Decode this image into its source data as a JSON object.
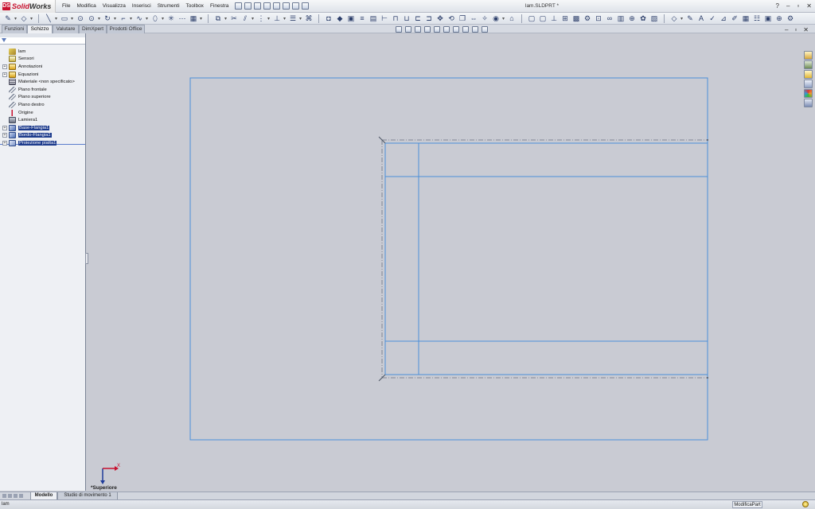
{
  "app": {
    "brand_bold": "Solid",
    "brand_rest": "Works",
    "logo_mark": "DS",
    "document_title": "lam.SLDPRT *"
  },
  "menu": [
    "File",
    "Modifica",
    "Visualizza",
    "Inserisci",
    "Strumenti",
    "Toolbox",
    "Finestra"
  ],
  "window_controls": {
    "help": "?",
    "minimize": "–",
    "restore": "▫",
    "close": "✕"
  },
  "command_tabs": [
    "Funzioni",
    "Schizzo",
    "Valutare",
    "DimXpert",
    "Prodotti Office"
  ],
  "active_command_tab": "Schizzo",
  "feature_tree": {
    "root": "lam",
    "items": [
      {
        "label": "Sensori",
        "expander": false,
        "icon": "sensor-icon",
        "selected": false
      },
      {
        "label": "Annotazioni",
        "expander": true,
        "icon": "annotations-icon",
        "selected": false
      },
      {
        "label": "Equazioni",
        "expander": true,
        "icon": "equations-icon",
        "selected": false
      },
      {
        "label": "Materiale <non specificato>",
        "expander": false,
        "icon": "material-icon",
        "selected": false
      },
      {
        "label": "Piano frontale",
        "expander": false,
        "icon": "plane-icon",
        "selected": false
      },
      {
        "label": "Piano superiore",
        "expander": false,
        "icon": "plane-icon",
        "selected": false
      },
      {
        "label": "Piano destro",
        "expander": false,
        "icon": "plane-icon",
        "selected": false
      },
      {
        "label": "Origine",
        "expander": false,
        "icon": "origin-icon",
        "selected": false
      },
      {
        "label": "Lamiera1",
        "expander": false,
        "icon": "sheet-metal-icon",
        "selected": false
      },
      {
        "label": "Base-Flangia1",
        "expander": true,
        "icon": "base-flange-icon",
        "selected": true
      },
      {
        "label": "Bordo-Flangia1",
        "expander": true,
        "icon": "edge-flange-icon",
        "selected": true
      },
      {
        "label": "Proiezione piatta1",
        "expander": true,
        "icon": "flat-pattern-icon",
        "selected": true
      }
    ]
  },
  "view": {
    "orientation_label": "*Superiore",
    "triad_x_label": "X"
  },
  "bottom_tabs": [
    "Modello",
    "Studio di movimento 1"
  ],
  "active_bottom_tab": "Modello",
  "status": {
    "document": "lam",
    "mode": "ModificaPart"
  },
  "colors": {
    "sketch_line": "#4a8fd8",
    "centerline": "#6b7280",
    "selection": "#1c3a8c",
    "canvas": "#c9cbd3"
  }
}
